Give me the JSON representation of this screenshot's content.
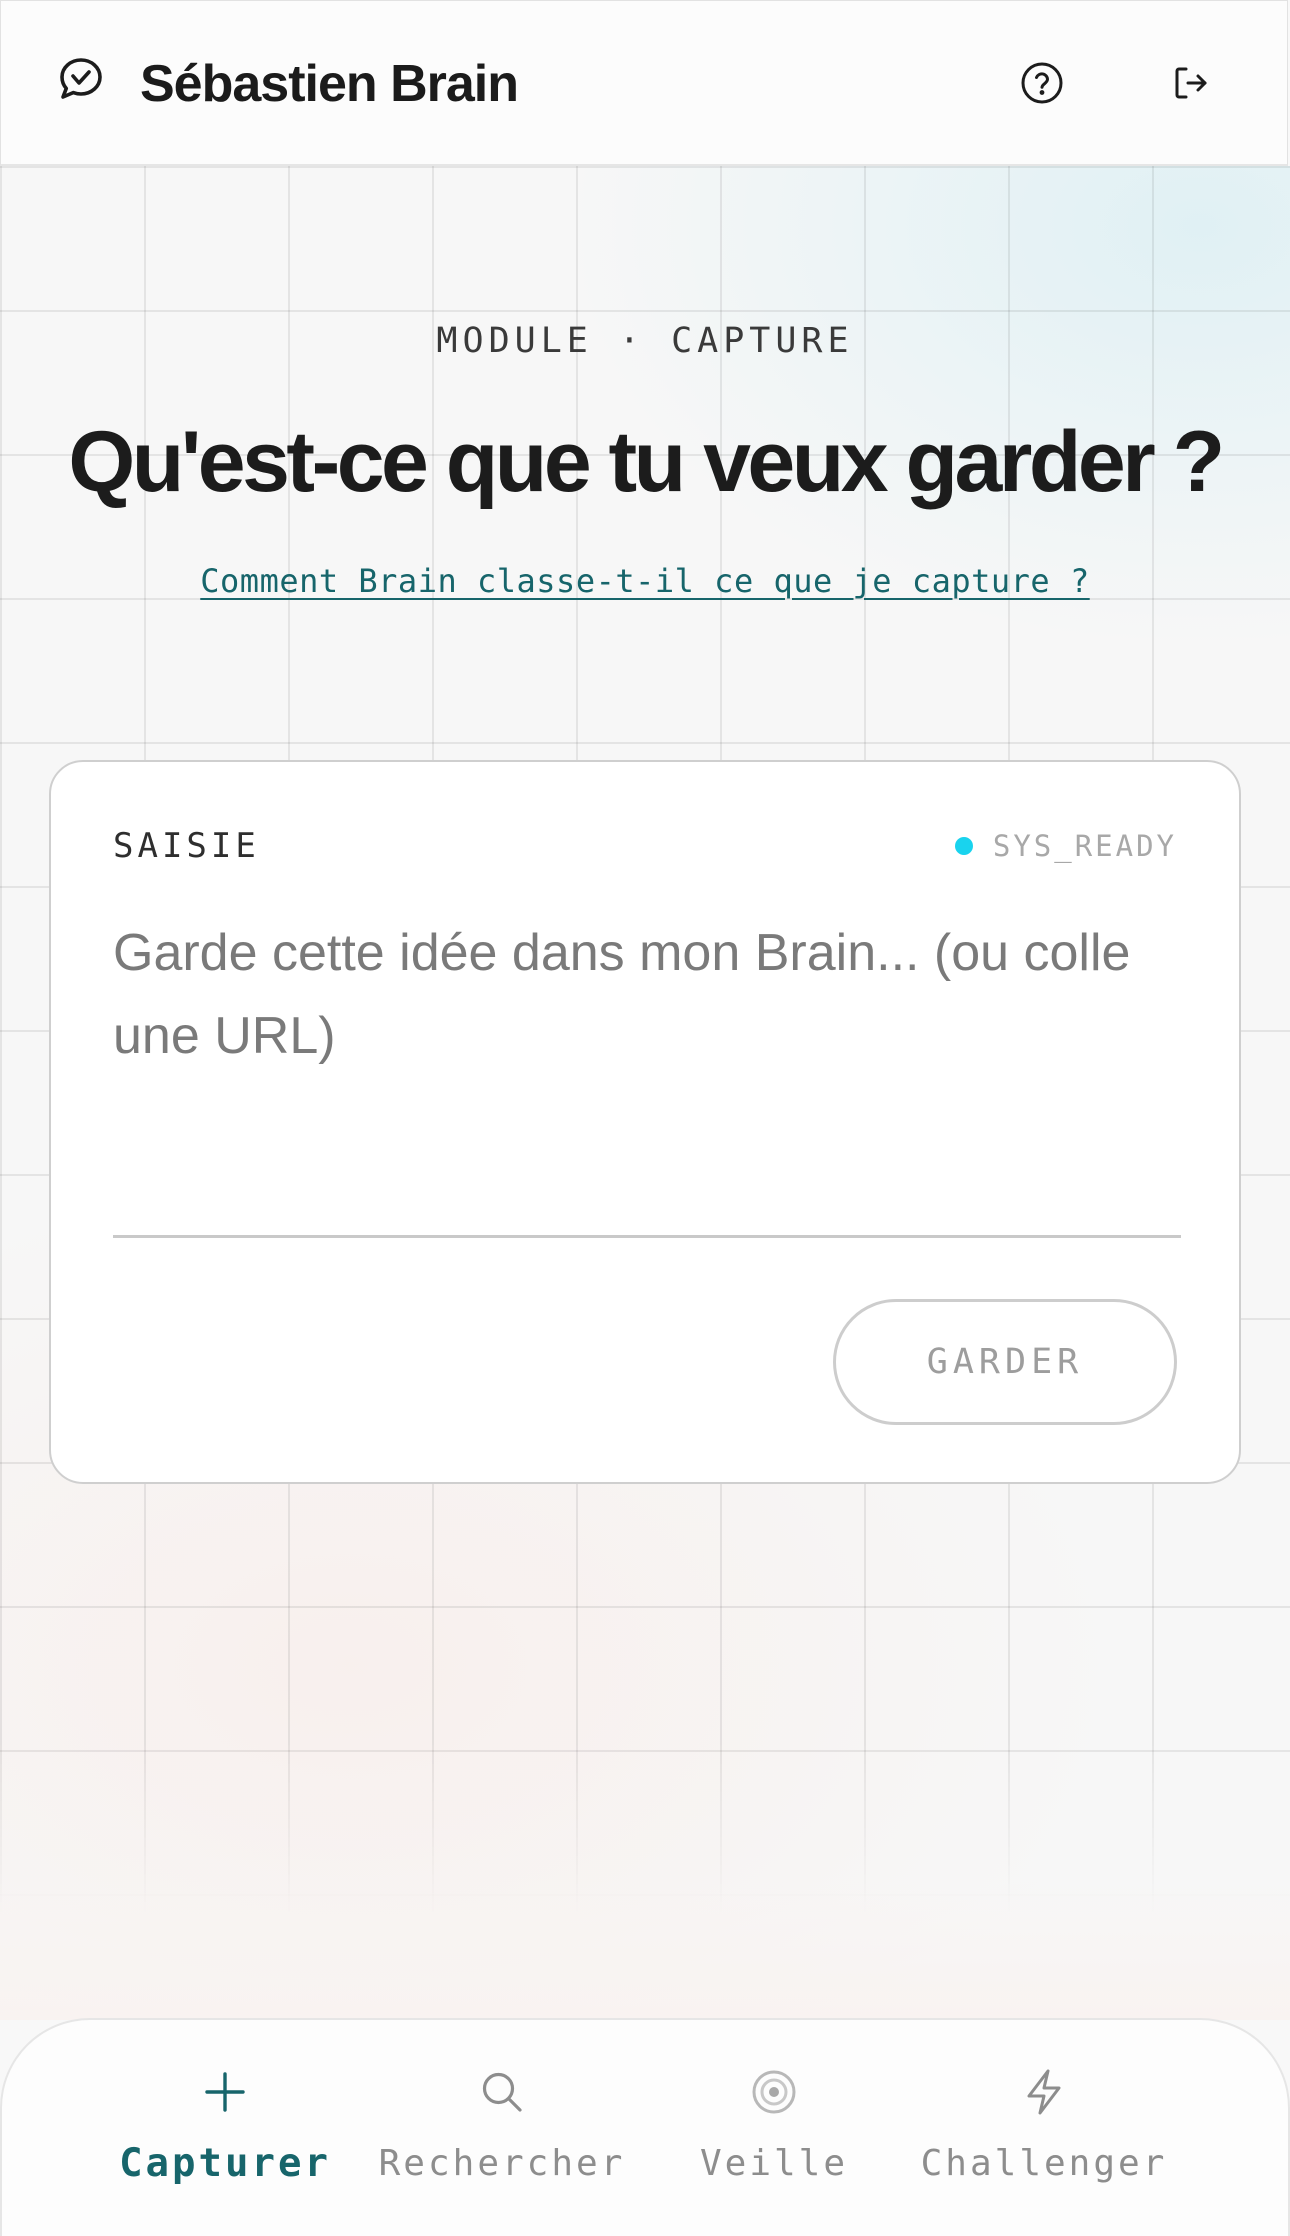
{
  "header": {
    "title": "Sébastien Brain",
    "logo_icon": "chat-bubble-logo-icon",
    "help_icon": "help-circle-icon",
    "logout_icon": "logout-icon"
  },
  "hero": {
    "kicker": "MODULE · CAPTURE",
    "headline": "Qu'est-ce que tu veux garder ?",
    "help_link": "Comment Brain classe-t-il ce que je capture ?"
  },
  "capture_card": {
    "label": "SAISIE",
    "status": "SYS_READY",
    "status_color": "#19d3ee",
    "input_value": "",
    "input_placeholder": "Garde cette idée dans mon Brain... (ou colle une URL)",
    "submit_label": "GARDER"
  },
  "bottom_nav": {
    "items": [
      {
        "label": "Capturer",
        "icon": "plus-icon",
        "active": true
      },
      {
        "label": "Rechercher",
        "icon": "search-icon",
        "active": false
      },
      {
        "label": "Veille",
        "icon": "radar-icon",
        "active": false
      },
      {
        "label": "Challenger",
        "icon": "lightning-icon",
        "active": false
      }
    ]
  },
  "colors": {
    "accent": "#17656b",
    "text": "#1c1c1c",
    "muted": "#8d8d8d"
  }
}
